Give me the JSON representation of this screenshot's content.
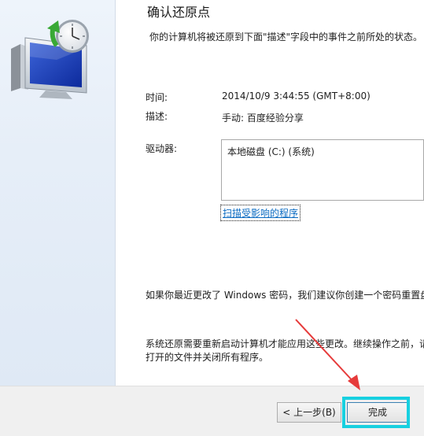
{
  "dialog": {
    "title": "确认还原点",
    "description": "你的计算机将被还原到下面\"描述\"字段中的事件之前所处的状态。",
    "time_label": "时间:",
    "time_value": "2014/10/9 3:44:55 (GMT+8:00)",
    "desc_label": "描述:",
    "desc_value": "手动: 百度经验分享",
    "drives_label": "驱动器:",
    "drives": [
      "本地磁盘 (C:) (系统)"
    ],
    "scan_link": "扫描受影响的程序",
    "password_note": "如果你最近更改了 Windows 密码，我们建议你创建一个密码重置盘",
    "restart_note_line1": "系统还原需要重新启动计算机才能应用这些更改。继续操作之前，请",
    "restart_note_line2": "打开的文件并关闭所有程序。"
  },
  "buttons": {
    "back_label": "< 上一步(B)",
    "finish_label": "完成"
  },
  "icons": {
    "wizard_image": "system-restore-monitor-clock-icon",
    "annotation": "red-arrow"
  },
  "colors": {
    "highlight": "#17d0e0",
    "arrow": "#e63b3b",
    "link": "#0b6bc2"
  }
}
